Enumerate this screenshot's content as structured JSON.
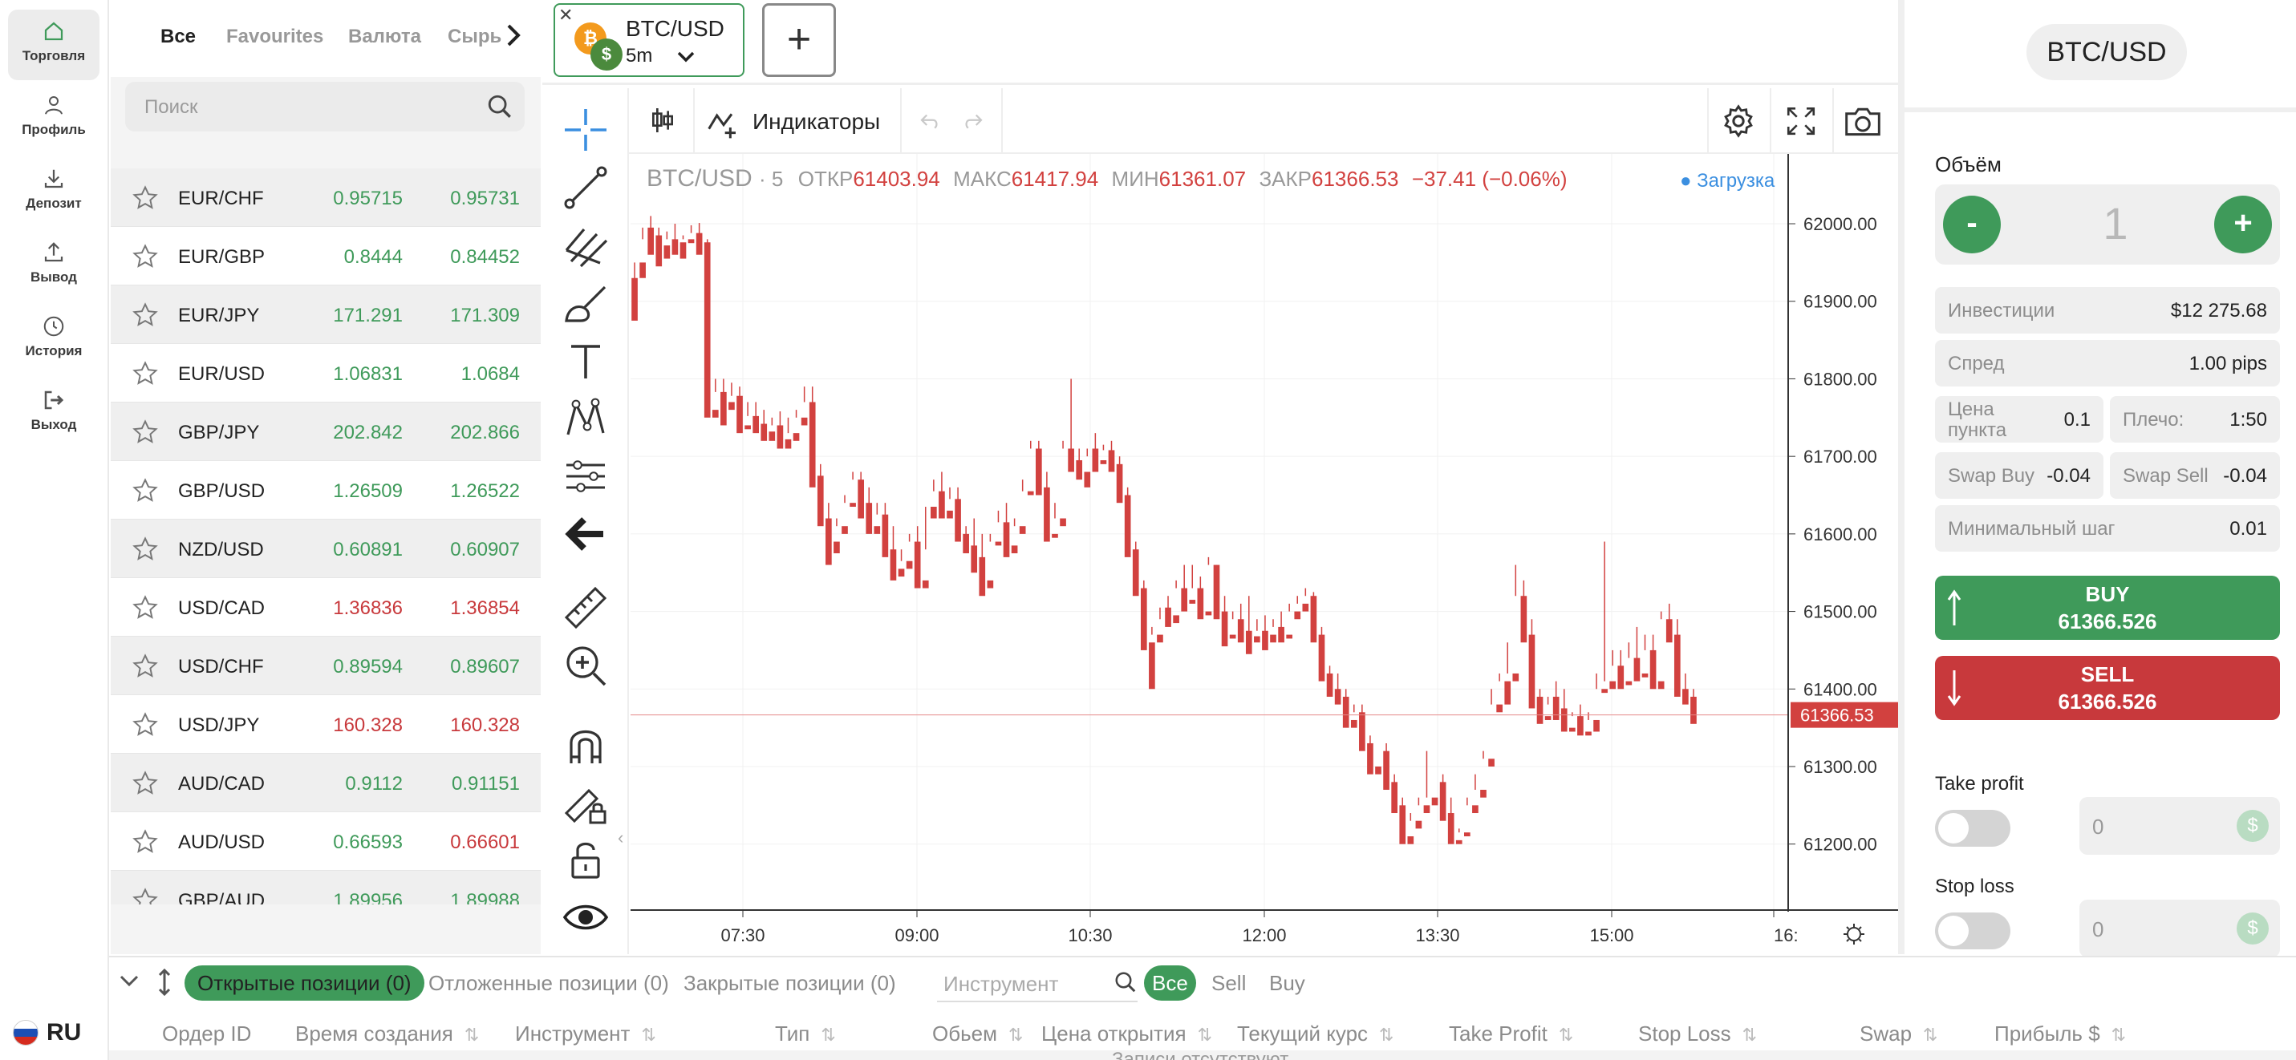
{
  "nav": {
    "items": [
      {
        "label": "Торговля",
        "icon": "home-icon"
      },
      {
        "label": "Профиль",
        "icon": "user-icon"
      },
      {
        "label": "Депозит",
        "icon": "download-icon"
      },
      {
        "label": "Вывод",
        "icon": "upload-icon"
      },
      {
        "label": "История",
        "icon": "clock-icon"
      },
      {
        "label": "Выход",
        "icon": "logout-icon"
      }
    ],
    "language": "RU"
  },
  "watchlist": {
    "tabs": [
      "Все",
      "Favourites",
      "Валюта",
      "Сырь"
    ],
    "search_placeholder": "Поиск",
    "rows": [
      {
        "symbol": "EUR/CHF",
        "bid": "0.95715",
        "ask": "0.95731",
        "bid_dir": "up",
        "ask_dir": "up"
      },
      {
        "symbol": "EUR/GBP",
        "bid": "0.8444",
        "ask": "0.84452",
        "bid_dir": "up",
        "ask_dir": "up"
      },
      {
        "symbol": "EUR/JPY",
        "bid": "171.291",
        "ask": "171.309",
        "bid_dir": "up",
        "ask_dir": "up"
      },
      {
        "symbol": "EUR/USD",
        "bid": "1.06831",
        "ask": "1.0684",
        "bid_dir": "up",
        "ask_dir": "up"
      },
      {
        "symbol": "GBP/JPY",
        "bid": "202.842",
        "ask": "202.866",
        "bid_dir": "up",
        "ask_dir": "up"
      },
      {
        "symbol": "GBP/USD",
        "bid": "1.26509",
        "ask": "1.26522",
        "bid_dir": "up",
        "ask_dir": "up"
      },
      {
        "symbol": "NZD/USD",
        "bid": "0.60891",
        "ask": "0.60907",
        "bid_dir": "up",
        "ask_dir": "up"
      },
      {
        "symbol": "USD/CAD",
        "bid": "1.36836",
        "ask": "1.36854",
        "bid_dir": "down",
        "ask_dir": "down"
      },
      {
        "symbol": "USD/CHF",
        "bid": "0.89594",
        "ask": "0.89607",
        "bid_dir": "up",
        "ask_dir": "up"
      },
      {
        "symbol": "USD/JPY",
        "bid": "160.328",
        "ask": "160.328",
        "bid_dir": "down",
        "ask_dir": "down"
      },
      {
        "symbol": "AUD/CAD",
        "bid": "0.9112",
        "ask": "0.91151",
        "bid_dir": "up",
        "ask_dir": "up"
      },
      {
        "symbol": "AUD/USD",
        "bid": "0.66593",
        "ask": "0.66601",
        "bid_dir": "up",
        "ask_dir": "down"
      },
      {
        "symbol": "GBP/AUD",
        "bid": "1.89956",
        "ask": "1.89988",
        "bid_dir": "up",
        "ask_dir": "up"
      }
    ]
  },
  "instrument_tab": {
    "symbol": "BTC/USD",
    "timeframe": "5m"
  },
  "chart_toolbar": {
    "indicators_label": "Индикаторы"
  },
  "legend": {
    "symbol": "BTC/USD",
    "interval": "· 5",
    "open_label": "ОТКР",
    "open": "61403.94",
    "high_label": "МАКС",
    "high": "61417.94",
    "low_label": "МИН",
    "low": "61361.07",
    "close_label": "ЗАКР",
    "close": "61366.53",
    "change": "−37.41 (−0.06%)",
    "loading": "Загрузка"
  },
  "colors": {
    "up": "#3f9a5a",
    "down": "#d2413f",
    "accent": "#3f9a5a",
    "sell": "#c8393c",
    "loading": "#3b8fe0"
  },
  "chart_data": {
    "type": "candlestick",
    "y_ticks": [
      "62000.00",
      "61900.00",
      "61800.00",
      "61700.00",
      "61600.00",
      "61500.00",
      "61400.00",
      "61300.00",
      "61200.00"
    ],
    "x_ticks": [
      "07:30",
      "09:00",
      "10:30",
      "12:00",
      "13:30",
      "15:00",
      "16:"
    ],
    "ylim": [
      61118,
      62090
    ],
    "last_price": "61366.53",
    "candles": [
      [
        61930,
        61950,
        61905,
        61875
      ],
      [
        61950,
        61995,
        61980,
        61930
      ],
      [
        61995,
        62010,
        61985,
        61960
      ],
      [
        61985,
        61995,
        61972,
        61945
      ],
      [
        61972,
        61990,
        61980,
        61955
      ],
      [
        61980,
        62000,
        61976,
        61960
      ],
      [
        61976,
        61985,
        61980,
        61955
      ],
      [
        61980,
        61998,
        61988,
        61975
      ],
      [
        61988,
        62001,
        61976,
        61960
      ],
      [
        61976,
        61980,
        61760,
        61750
      ],
      [
        61760,
        61800,
        61783,
        61750
      ],
      [
        61783,
        61800,
        61770,
        61740
      ],
      [
        61770,
        61795,
        61778,
        61760
      ],
      [
        61778,
        61790,
        61740,
        61730
      ],
      [
        61740,
        61770,
        61752,
        61735
      ],
      [
        61752,
        61770,
        61742,
        61730
      ],
      [
        61742,
        61760,
        61732,
        61720
      ],
      [
        61732,
        61750,
        61740,
        61720
      ],
      [
        61740,
        61758,
        61722,
        61710
      ],
      [
        61722,
        61750,
        61730,
        61710
      ],
      [
        61730,
        61760,
        61750,
        61720
      ],
      [
        61750,
        61790,
        61770,
        61740
      ],
      [
        61770,
        61790,
        61675,
        61660
      ],
      [
        61675,
        61690,
        61620,
        61610
      ],
      [
        61620,
        61640,
        61590,
        61560
      ],
      [
        61590,
        61620,
        61610,
        61575
      ],
      [
        61610,
        61650,
        61640,
        61600
      ],
      [
        61640,
        61680,
        61670,
        61635
      ],
      [
        61670,
        61680,
        61640,
        61620
      ],
      [
        61640,
        61660,
        61610,
        61600
      ],
      [
        61610,
        61640,
        61625,
        61600
      ],
      [
        61625,
        61640,
        61580,
        61570
      ],
      [
        61580,
        61610,
        61555,
        61540
      ],
      [
        61555,
        61580,
        61565,
        61545
      ],
      [
        61565,
        61600,
        61590,
        61555
      ],
      [
        61590,
        61610,
        61540,
        61530
      ],
      [
        61540,
        61580,
        61635,
        61530
      ],
      [
        61635,
        61670,
        61655,
        61620
      ],
      [
        61655,
        61680,
        61630,
        61620
      ],
      [
        61630,
        61660,
        61645,
        61620
      ],
      [
        61645,
        61660,
        61600,
        61590
      ],
      [
        61600,
        61610,
        61585,
        61575
      ],
      [
        61585,
        61620,
        61570,
        61550
      ],
      [
        61570,
        61600,
        61540,
        61520
      ],
      [
        61540,
        61600,
        61590,
        61530
      ],
      [
        61590,
        61630,
        61615,
        61585
      ],
      [
        61615,
        61640,
        61585,
        61570
      ],
      [
        61585,
        61620,
        61610,
        61575
      ],
      [
        61610,
        61670,
        61655,
        61600
      ],
      [
        61655,
        61720,
        61710,
        61650
      ],
      [
        61710,
        61720,
        61660,
        61650
      ],
      [
        61660,
        61680,
        61600,
        61590
      ],
      [
        61600,
        61640,
        61620,
        61595
      ],
      [
        61620,
        61720,
        61710,
        61610
      ],
      [
        61710,
        61800,
        61695,
        61680
      ],
      [
        61695,
        61710,
        61680,
        61670
      ],
      [
        61680,
        61700,
        61710,
        61660
      ],
      [
        61710,
        61730,
        61695,
        61680
      ],
      [
        61695,
        61715,
        61708,
        61690
      ],
      [
        61708,
        61720,
        61690,
        61680
      ],
      [
        61690,
        61700,
        61650,
        61640
      ],
      [
        61650,
        61660,
        61580,
        61570
      ],
      [
        61580,
        61590,
        61530,
        61520
      ],
      [
        61530,
        61540,
        61460,
        61450
      ],
      [
        61460,
        61480,
        61470,
        61400
      ],
      [
        61470,
        61490,
        61505,
        61460
      ],
      [
        61505,
        61520,
        61495,
        61480
      ],
      [
        61495,
        61540,
        61530,
        61485
      ],
      [
        61530,
        61560,
        61515,
        61500
      ],
      [
        61515,
        61560,
        61530,
        61510
      ],
      [
        61530,
        61545,
        61500,
        61490
      ],
      [
        61500,
        61570,
        61560,
        61495
      ],
      [
        61560,
        61560,
        61500,
        61490
      ],
      [
        61500,
        61520,
        61470,
        61455
      ],
      [
        61470,
        61500,
        61490,
        61465
      ],
      [
        61490,
        61510,
        61475,
        61460
      ],
      [
        61475,
        61520,
        61468,
        61445
      ],
      [
        61468,
        61490,
        61475,
        61460
      ],
      [
        61475,
        61495,
        61470,
        61450
      ],
      [
        61470,
        61490,
        61480,
        61460
      ],
      [
        61480,
        61500,
        61470,
        61460
      ],
      [
        61470,
        61510,
        61500,
        61465
      ],
      [
        61500,
        61520,
        61510,
        61490
      ],
      [
        61510,
        61530,
        61520,
        61500
      ],
      [
        61520,
        61525,
        61470,
        61460
      ],
      [
        61470,
        61480,
        61420,
        61410
      ],
      [
        61420,
        61430,
        61400,
        61390
      ],
      [
        61400,
        61420,
        61390,
        61380
      ],
      [
        61390,
        61400,
        61360,
        61350
      ],
      [
        61360,
        61380,
        61370,
        61350
      ],
      [
        61370,
        61380,
        61330,
        61320
      ],
      [
        61330,
        61340,
        61300,
        61290
      ],
      [
        61300,
        61320,
        61320,
        61290
      ],
      [
        61320,
        61330,
        61280,
        61270
      ],
      [
        61280,
        61290,
        61250,
        61240
      ],
      [
        61250,
        61260,
        61210,
        61200
      ],
      [
        61210,
        61240,
        61230,
        61200
      ],
      [
        61230,
        61260,
        61250,
        61220
      ],
      [
        61250,
        61320,
        61260,
        61240
      ],
      [
        61260,
        61280,
        61280,
        61250
      ],
      [
        61280,
        61290,
        61240,
        61230
      ],
      [
        61240,
        61260,
        61205,
        61200
      ],
      [
        61205,
        61220,
        61215,
        61200
      ],
      [
        61215,
        61260,
        61250,
        61210
      ],
      [
        61250,
        61290,
        61270,
        61240
      ],
      [
        61270,
        61320,
        61310,
        61260
      ],
      [
        61310,
        61400,
        61380,
        61300
      ],
      [
        61380,
        61420,
        61410,
        61370
      ],
      [
        61410,
        61460,
        61420,
        61380
      ],
      [
        61420,
        61560,
        61520,
        61410
      ],
      [
        61520,
        61540,
        61470,
        61460
      ],
      [
        61470,
        61490,
        61390,
        61375
      ],
      [
        61390,
        61400,
        61365,
        61355
      ],
      [
        61365,
        61380,
        61390,
        61360
      ],
      [
        61390,
        61410,
        61375,
        61360
      ],
      [
        61375,
        61400,
        61350,
        61345
      ],
      [
        61350,
        61370,
        61365,
        61345
      ],
      [
        61365,
        61380,
        61345,
        61340
      ],
      [
        61345,
        61370,
        61360,
        61340
      ],
      [
        61360,
        61420,
        61400,
        61345
      ],
      [
        61400,
        61590,
        61410,
        61395
      ],
      [
        61410,
        61450,
        61430,
        61400
      ],
      [
        61430,
        61450,
        61410,
        61400
      ],
      [
        61410,
        61460,
        61440,
        61405
      ],
      [
        61440,
        61480,
        61420,
        61410
      ],
      [
        61420,
        61470,
        61450,
        61415
      ],
      [
        61450,
        61470,
        61410,
        61400
      ],
      [
        61410,
        61500,
        61490,
        61400
      ],
      [
        61490,
        61510,
        61470,
        61460
      ],
      [
        61470,
        61490,
        61400,
        61390
      ],
      [
        61400,
        61420,
        61390,
        61380
      ],
      [
        61390,
        61400,
        61360,
        61355
      ]
    ]
  },
  "right_panel": {
    "symbol": "BTC/USD",
    "volume_label": "Объём",
    "volume_value": "1",
    "minus": "-",
    "plus": "+",
    "investments_label": "Инвестиции",
    "investments_value": "$12 275.68",
    "spread_label": "Спред",
    "spread_value": "1.00 pips",
    "point_label": "Цена пункта",
    "point_value": "0.1",
    "leverage_label": "Плечо:",
    "leverage_value": "1:50",
    "swap_buy_label": "Swap Buy",
    "swap_buy_value": "-0.04",
    "swap_sell_label": "Swap Sell",
    "swap_sell_value": "-0.04",
    "min_step_label": "Минимальный шаг",
    "min_step_value": "0.01",
    "buy_label": "BUY",
    "buy_price": "61366.526",
    "sell_label": "SELL",
    "sell_price": "61366.526",
    "take_profit_label": "Take profit",
    "take_profit_value": "0",
    "stop_loss_label": "Stop loss",
    "stop_loss_value": "0",
    "currency_symbol": "$"
  },
  "positions": {
    "tabs": [
      "Открытые позиции (0)",
      "Отложенные позиции (0)",
      "Закрытые позиции (0)"
    ],
    "instrument_placeholder": "Инструмент",
    "filters": [
      "Все",
      "Sell",
      "Buy"
    ],
    "columns": [
      "Ордер ID",
      "Время создания",
      "Инструмент",
      "Тип",
      "Обьем",
      "Цена открытия",
      "Текущий курс",
      "Take Profit",
      "Stop Loss",
      "Swap",
      "Прибыль $"
    ],
    "empty_text": "Записи отсутствуют"
  }
}
